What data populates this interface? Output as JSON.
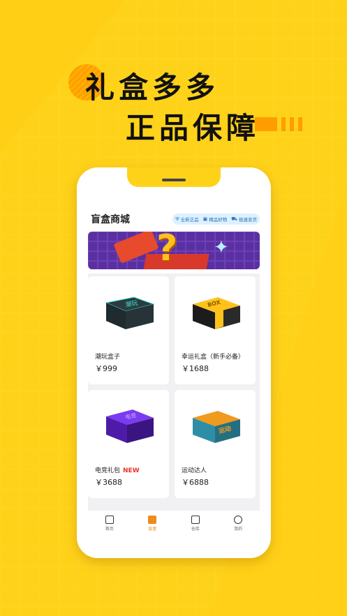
{
  "headline": {
    "line1": "礼盒多多",
    "line2": "正品保障"
  },
  "colors": {
    "background": "#FFD21A",
    "accent": "#F08A1B",
    "new_badge": "#E8312A",
    "tag_text": "#2D6FB8"
  },
  "shop": {
    "title": "盲盒商城",
    "tags": [
      {
        "icon": "shield-icon",
        "label": "全新正品"
      },
      {
        "icon": "gift-icon",
        "label": "精品好物"
      },
      {
        "icon": "truck-icon",
        "label": "极速发货"
      }
    ]
  },
  "banner": {
    "icon": "question-mark-icon",
    "text": "?"
  },
  "products": [
    {
      "name": "潮玩盒子",
      "price": "￥999",
      "badge": "",
      "box_label": "潮玩",
      "box_color": "#1F2B2E",
      "accent": "#38E0D0"
    },
    {
      "name": "幸运礼盒（新手必备）",
      "price": "￥1688",
      "badge": "",
      "box_label": "BOX",
      "box_color": "#FFC21A",
      "accent": "#1C1C1C"
    },
    {
      "name": "电竞礼包",
      "price": "￥3688",
      "badge": "NEW",
      "box_label": "电竞",
      "box_color": "#6A2BD6",
      "accent": "#2A1150"
    },
    {
      "name": "运动达人",
      "price": "￥6888",
      "badge": "",
      "box_label": "运动",
      "box_color": "#2E8EA6",
      "accent": "#F09A1E"
    }
  ],
  "tabbar": [
    {
      "label": "首页",
      "icon": "home-icon",
      "active": false
    },
    {
      "label": "盲盒",
      "icon": "box-icon",
      "active": true
    },
    {
      "label": "仓库",
      "icon": "warehouse-icon",
      "active": false
    },
    {
      "label": "我的",
      "icon": "profile-icon",
      "active": false
    }
  ]
}
